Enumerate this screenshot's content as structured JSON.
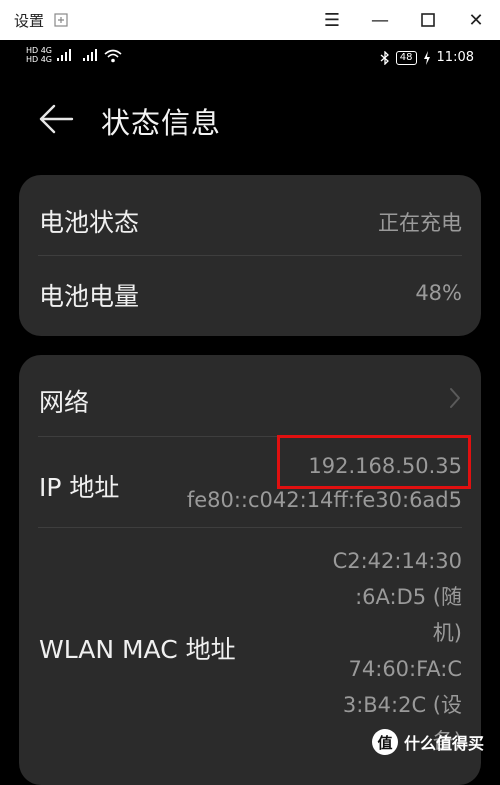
{
  "window": {
    "title": "设置",
    "controls": [
      "menu-icon",
      "minimize-icon",
      "maximize-icon",
      "close-icon"
    ]
  },
  "statusbar": {
    "sim1": "HD 4G",
    "sim2": "HD 4G",
    "battery": "48",
    "time": "11:08",
    "icons": [
      "bluetooth-icon",
      "wifi-icon",
      "charging-icon"
    ]
  },
  "header": {
    "title": "状态信息"
  },
  "battery_card": {
    "status_label": "电池状态",
    "status_value": "正在充电",
    "level_label": "电池电量",
    "level_value": "48%"
  },
  "network_card": {
    "network_label": "网络",
    "ip_label": "IP 地址",
    "ip_v4": "192.168.50.35",
    "ip_v6": "fe80::c042:14ff:fe30:6ad5",
    "mac_label": "WLAN MAC 地址",
    "mac_lines": [
      "C2:42:14:30",
      ":6A:D5 (随",
      "机)",
      "74:60:FA:C",
      "3:B4:2C (设",
      "备)"
    ]
  },
  "watermark": {
    "logo": "值",
    "text": "什么值得买"
  },
  "colors": {
    "background": "#000000",
    "card": "#2b2b2b",
    "label": "#f0f0f0",
    "value": "#9a9a9a",
    "highlight": "#e01010"
  }
}
